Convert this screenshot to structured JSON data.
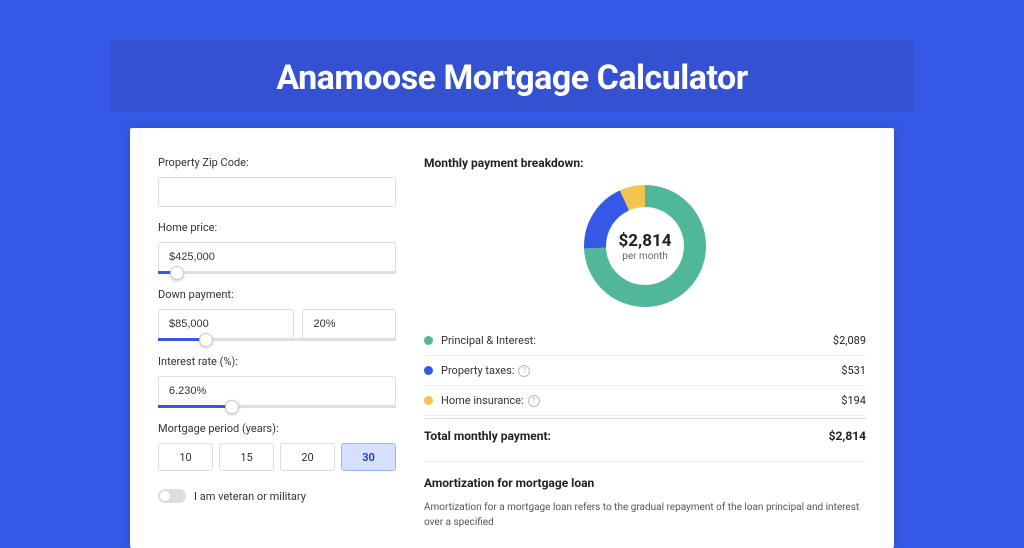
{
  "page": {
    "title": "Anamoose Mortgage Calculator"
  },
  "form": {
    "zip": {
      "label": "Property Zip Code:",
      "value": ""
    },
    "home_price": {
      "label": "Home price:",
      "value": "$425,000",
      "slider_pct": 8
    },
    "down_payment": {
      "label": "Down payment:",
      "amount": "$85,000",
      "percent": "20%",
      "slider_pct": 20
    },
    "interest": {
      "label": "Interest rate (%):",
      "value": "6.230%",
      "slider_pct": 31
    },
    "period": {
      "label": "Mortgage period (years):",
      "options": [
        "10",
        "15",
        "20",
        "30"
      ],
      "selected": "30"
    },
    "veteran": {
      "label": "I am veteran or military",
      "checked": false
    }
  },
  "breakdown": {
    "title": "Monthly payment breakdown:",
    "center_amount": "$2,814",
    "center_sub": "per month",
    "items": [
      {
        "label": "Principal & Interest:",
        "value": "$2,089",
        "color": "#50B79A",
        "info": false,
        "pct": 74.2
      },
      {
        "label": "Property taxes:",
        "value": "$531",
        "color": "#3558E6",
        "info": true,
        "pct": 18.9
      },
      {
        "label": "Home insurance:",
        "value": "$194",
        "color": "#F3C54E",
        "info": true,
        "pct": 6.9
      }
    ],
    "total": {
      "label": "Total monthly payment:",
      "value": "$2,814"
    }
  },
  "amort": {
    "title": "Amortization for mortgage loan",
    "text": "Amortization for a mortgage loan refers to the gradual repayment of the loan principal and interest over a specified"
  },
  "chart_data": {
    "type": "pie",
    "title": "Monthly payment breakdown",
    "categories": [
      "Principal & Interest",
      "Property taxes",
      "Home insurance"
    ],
    "values": [
      2089,
      531,
      194
    ],
    "total": 2814,
    "colors": [
      "#50B79A",
      "#3558E6",
      "#F3C54E"
    ]
  }
}
